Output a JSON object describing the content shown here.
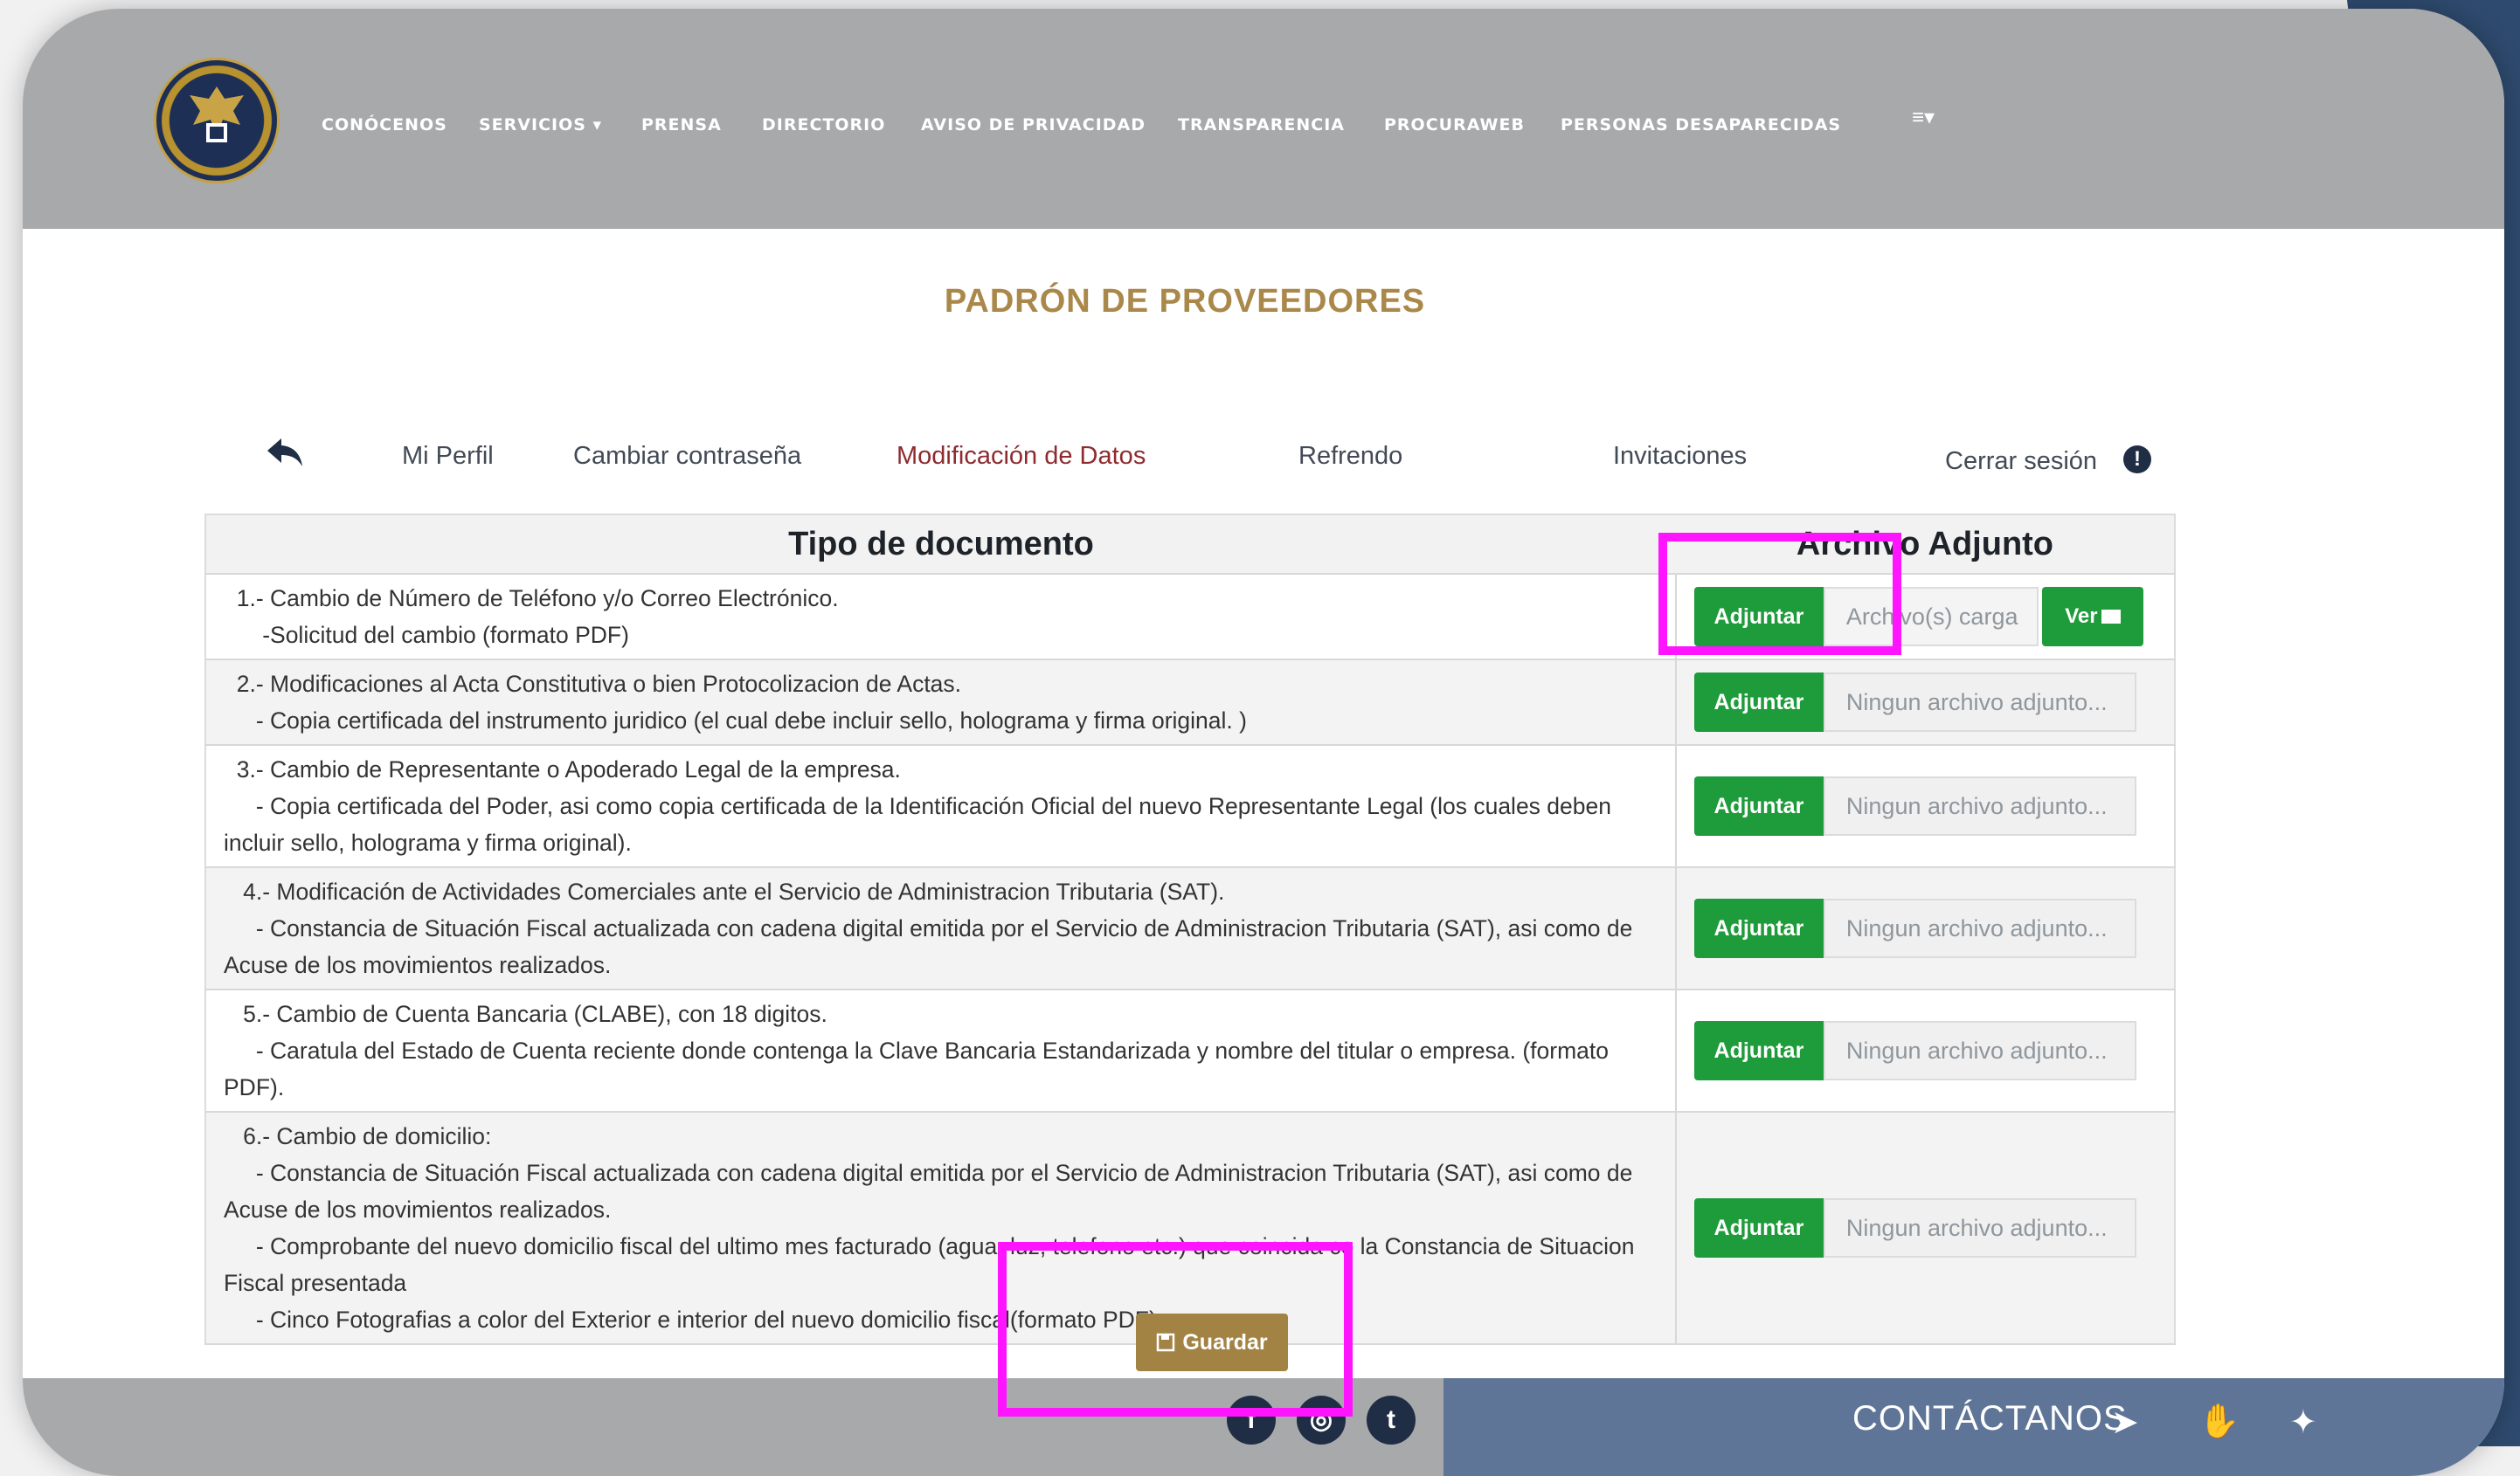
{
  "nav": {
    "items": [
      "CONÓCENOS",
      "SERVICIOS ▾",
      "PRENSA",
      "DIRECTORIO",
      "AVISO DE PRIVACIDAD",
      "TRANSPARENCIA",
      "PROCURAWEB",
      "PERSONAS DESAPARECIDAS"
    ],
    "menu_icon": "≡▾"
  },
  "page_title": "PADRÓN DE PROVEEDORES",
  "tabs": {
    "perfil": "Mi Perfil",
    "contrasena": "Cambiar contraseña",
    "modificacion": "Modificación de Datos",
    "refrendo": "Refrendo",
    "invitaciones": "Invitaciones",
    "cerrar": "Cerrar sesión"
  },
  "table": {
    "header_doc": "Tipo de documento",
    "header_att": "Archivo Adjunto",
    "adjuntar_label": "Adjuntar",
    "ver_label": "Ver",
    "rows": [
      {
        "lines": [
          "  1.- Cambio de Número de Teléfono y/o Correo Electrónico.",
          "      -Solicitud del cambio (formato PDF)"
        ],
        "file": "Archivo(s) carga"
      },
      {
        "lines": [
          "  2.- Modificaciones al Acta Constitutiva o bien Protocolizacion de Actas.",
          "     - Copia certificada del instrumento juridico (el cual debe incluir sello, holograma y firma original. )"
        ],
        "file": "Ningun archivo adjunto..."
      },
      {
        "lines": [
          "  3.- Cambio de Representante o Apoderado Legal de la empresa.",
          "     - Copia certificada del Poder, asi como copia certificada de la Identificación Oficial del nuevo Representante Legal (los cuales deben incluir sello, holograma y firma original)."
        ],
        "file": "Ningun archivo adjunto..."
      },
      {
        "lines": [
          "   4.- Modificación de Actividades Comerciales ante el Servicio de Administracion Tributaria (SAT).",
          "     - Constancia de Situación Fiscal actualizada con cadena digital emitida por el Servicio de Administracion Tributaria (SAT), asi como de Acuse de los movimientos realizados."
        ],
        "file": "Ningun archivo adjunto..."
      },
      {
        "lines": [
          "   5.- Cambio de Cuenta Bancaria (CLABE), con 18 digitos.",
          "     - Caratula del Estado de Cuenta reciente donde contenga la Clave Bancaria Estandarizada y nombre del titular o empresa. (formato PDF)."
        ],
        "file": "Ningun archivo adjunto..."
      },
      {
        "lines": [
          "   6.- Cambio de domicilio:",
          "     - Constancia de Situación Fiscal actualizada con cadena digital emitida por el Servicio de Administracion Tributaria (SAT), asi como de Acuse de los movimientos realizados.",
          "     - Comprobante del nuevo domicilio fiscal del ultimo mes facturado (agua, luz, telefono etc.) que coincida co la Constancia de Situacion Fiscal presentada",
          "     - Cinco Fotografias a color del Exterior e interior del nuevo domicilio fiscal(formato PDF)."
        ],
        "file": "Ningun archivo adjunto..."
      }
    ]
  },
  "guardar_label": "Guardar",
  "footer": {
    "social": [
      "f",
      "◎",
      "t"
    ],
    "contact_label": "CONTÁCTANOS",
    "contact_icons": [
      "paper-plane-icon",
      "hands-icon",
      "twitter-icon"
    ]
  },
  "colors": {
    "title_gold": "#a9884a",
    "active_tab": "#8e2b2f",
    "button_green": "#1e9b3a",
    "guardar_gold": "#a28344",
    "highlight_magenta": "#ff14ff"
  }
}
